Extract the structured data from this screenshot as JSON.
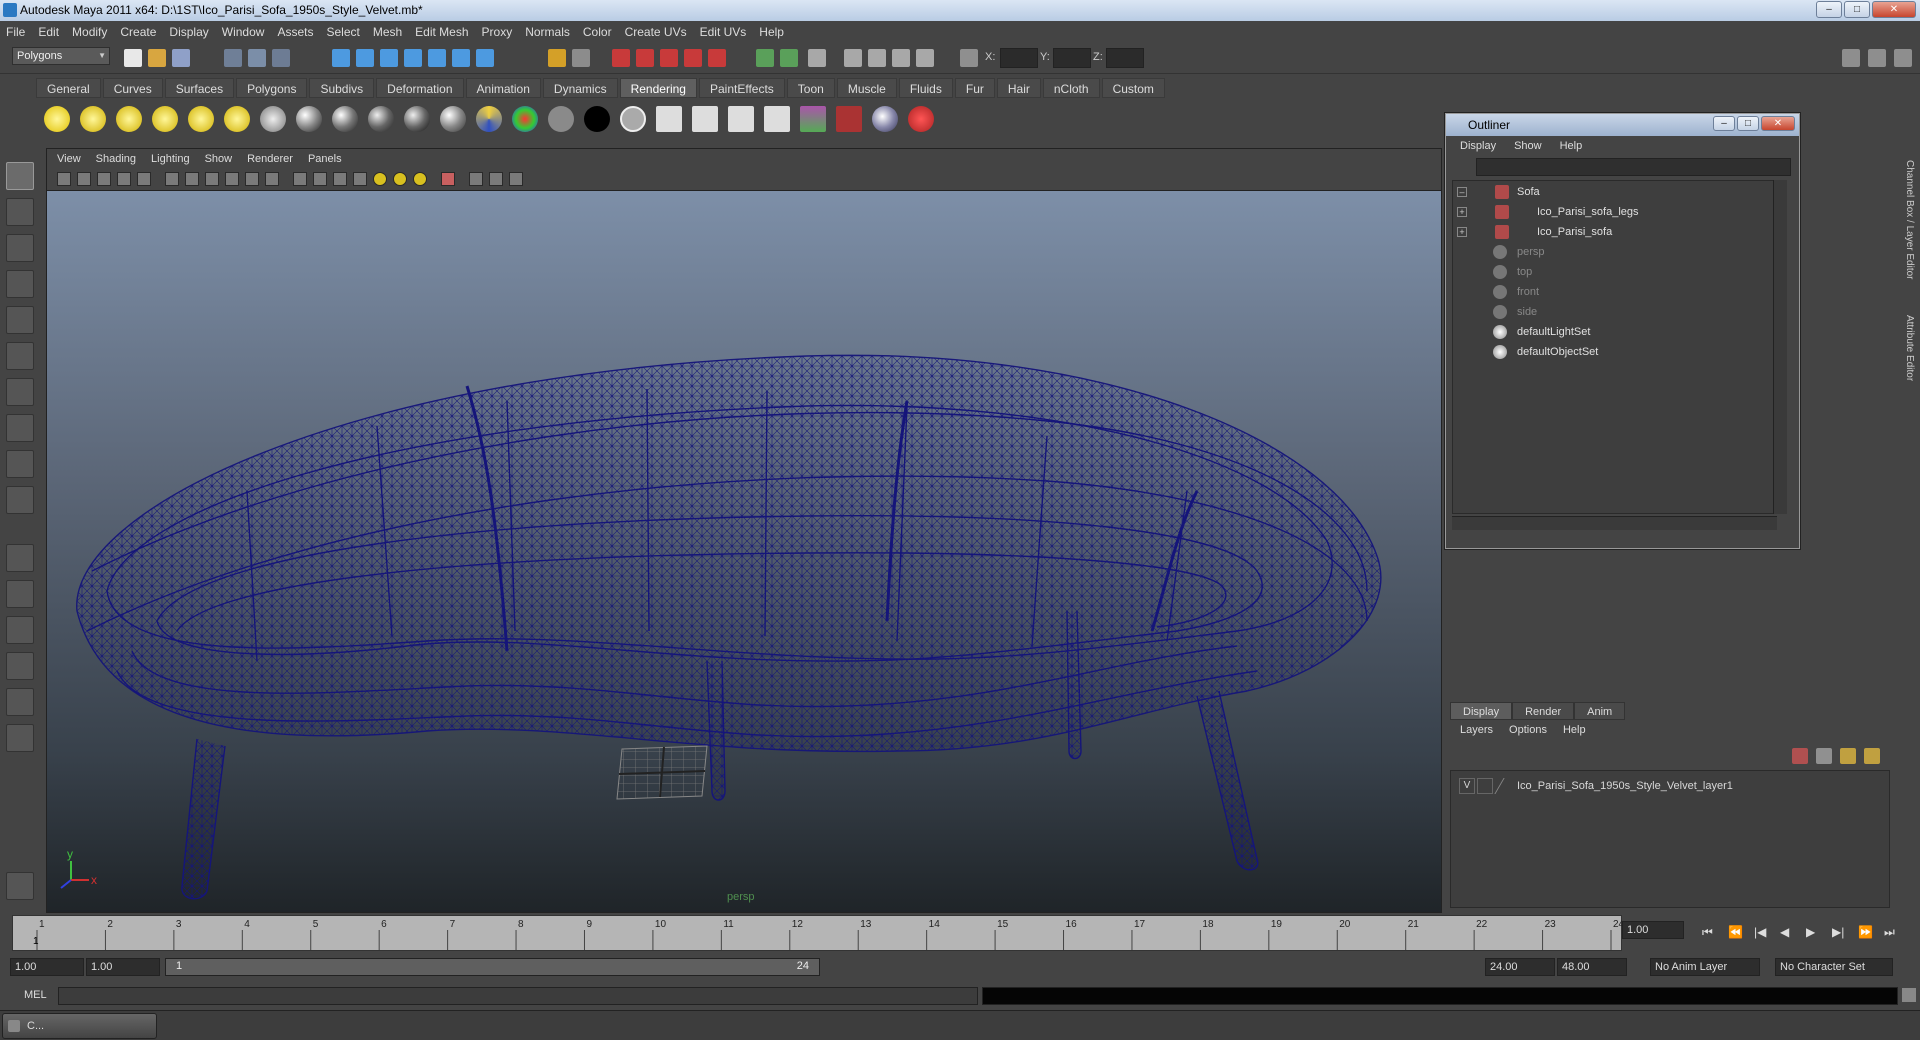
{
  "window": {
    "title": "Autodesk Maya 2011 x64: D:\\1ST\\Ico_Parisi_Sofa_1950s_Style_Velvet.mb*",
    "buttons": [
      "–",
      "□",
      "✕"
    ]
  },
  "menubar": [
    "File",
    "Edit",
    "Modify",
    "Create",
    "Display",
    "Window",
    "Assets",
    "Select",
    "Mesh",
    "Edit Mesh",
    "Proxy",
    "Normals",
    "Color",
    "Create UVs",
    "Edit UVs",
    "Help"
  ],
  "statusline": {
    "menu_set": "Polygons",
    "x_label": "X:",
    "y_label": "Y:",
    "z_label": "Z:"
  },
  "shelf_tabs": [
    "General",
    "Curves",
    "Surfaces",
    "Polygons",
    "Subdivs",
    "Deformation",
    "Animation",
    "Dynamics",
    "Rendering",
    "PaintEffects",
    "Toon",
    "Muscle",
    "Fluids",
    "Fur",
    "Hair",
    "nCloth",
    "Custom"
  ],
  "shelf_active_tab": "Rendering",
  "viewport": {
    "menu": [
      "View",
      "Shading",
      "Lighting",
      "Show",
      "Renderer",
      "Panels"
    ],
    "camera_label": "persp",
    "axis_y": "y",
    "axis_x": "x",
    "wire_color": "#15157a"
  },
  "outliner": {
    "title": "Outliner",
    "menu": [
      "Display",
      "Show",
      "Help"
    ],
    "items": [
      {
        "label": "Sofa",
        "dim": false,
        "expand": "–"
      },
      {
        "label": "Ico_Parisi_sofa_legs",
        "dim": false,
        "expand": "+"
      },
      {
        "label": "Ico_Parisi_sofa",
        "dim": false,
        "expand": "+"
      },
      {
        "label": "persp",
        "dim": true,
        "expand": ""
      },
      {
        "label": "top",
        "dim": true,
        "expand": ""
      },
      {
        "label": "front",
        "dim": true,
        "expand": ""
      },
      {
        "label": "side",
        "dim": true,
        "expand": ""
      },
      {
        "label": "defaultLightSet",
        "dim": false,
        "expand": ""
      },
      {
        "label": "defaultObjectSet",
        "dim": false,
        "expand": ""
      }
    ]
  },
  "layer_editor": {
    "tabs": [
      "Display",
      "Render",
      "Anim"
    ],
    "menu": [
      "Layers",
      "Options",
      "Help"
    ],
    "layer_visibility": "V",
    "layer_name": "Ico_Parisi_Sofa_1950s_Style_Velvet_layer1"
  },
  "side_tabs": [
    "Channel Box / Layer Editor",
    "Attribute Editor"
  ],
  "timeline": {
    "frames": [
      "1",
      "2",
      "3",
      "4",
      "5",
      "6",
      "7",
      "8",
      "9",
      "10",
      "11",
      "12",
      "13",
      "14",
      "15",
      "16",
      "17",
      "18",
      "19",
      "20",
      "21",
      "22",
      "23",
      "24"
    ],
    "current_frame_marker": "1",
    "current_time": "1.00"
  },
  "range": {
    "start_time": "1.00",
    "playback_start": "1.00",
    "slider_start": "1",
    "slider_end": "24",
    "playback_end": "24.00",
    "end_time": "48.00",
    "anim_layer": "No Anim Layer",
    "character_set": "No Character Set"
  },
  "commandline": {
    "label": "MEL"
  },
  "taskbar": {
    "label": "C..."
  }
}
